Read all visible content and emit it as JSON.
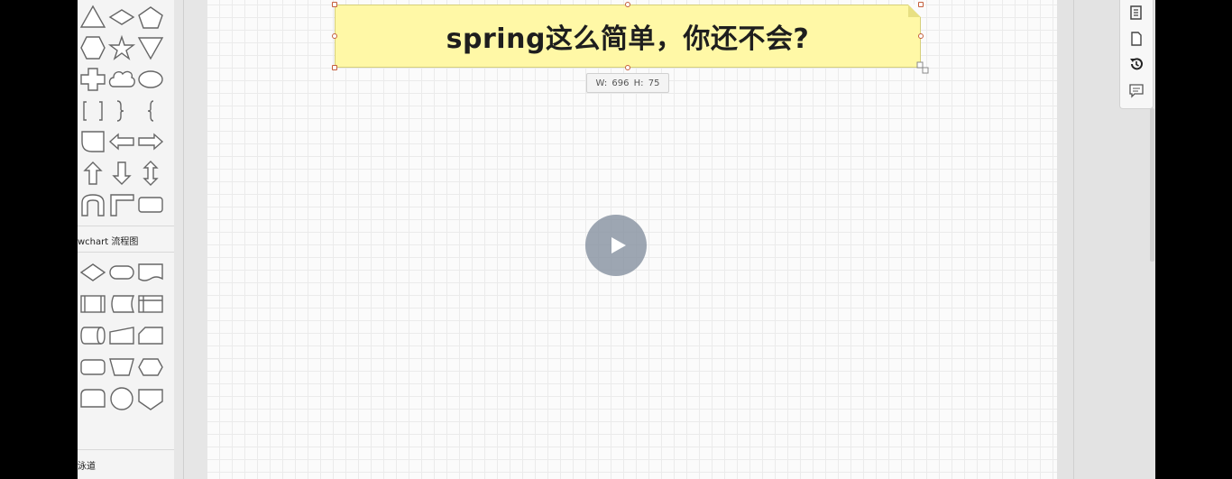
{
  "palette": {
    "section_flowchart": "wchart 流程图",
    "section_swimlane": "泳道"
  },
  "note": {
    "text": "spring这么简单，你还不会?",
    "fill_color": "#fff8a6"
  },
  "size_tooltip": {
    "text": "W: 696  H: 75"
  },
  "toolbar": {
    "icons": [
      "page-format-icon",
      "blank-page-icon",
      "history-icon",
      "comment-icon"
    ]
  },
  "video": {
    "play_icon": "play-icon"
  }
}
